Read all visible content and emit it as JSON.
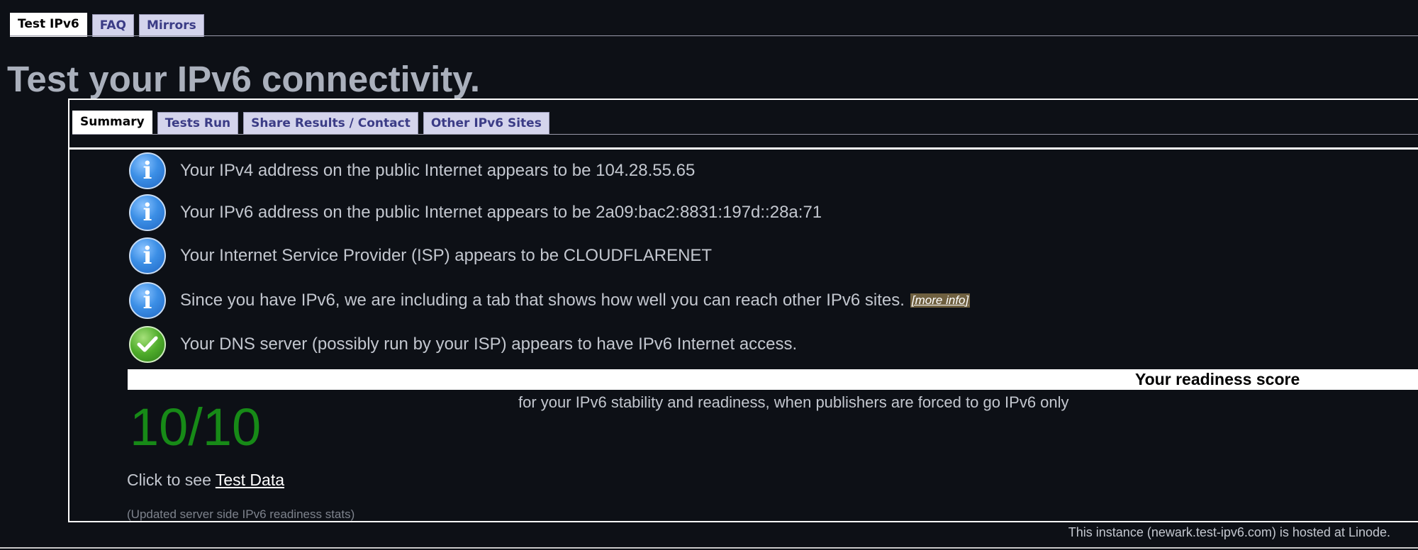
{
  "top_tabs": [
    {
      "label": "Test IPv6",
      "active": true
    },
    {
      "label": "FAQ",
      "active": false
    },
    {
      "label": "Mirrors",
      "active": false
    }
  ],
  "page_title": "Test your IPv6 connectivity.",
  "inner_tabs": [
    {
      "label": "Summary",
      "active": true
    },
    {
      "label": "Tests Run",
      "active": false
    },
    {
      "label": "Share Results / Contact",
      "active": false
    },
    {
      "label": "Other IPv6 Sites",
      "active": false
    }
  ],
  "messages": [
    {
      "icon": "info-icon",
      "text": "Your IPv4 address on the public Internet appears to be 104.28.55.65"
    },
    {
      "icon": "info-icon",
      "text": "Your IPv6 address on the public Internet appears to be 2a09:bac2:8831:197d::28a:71"
    },
    {
      "icon": "info-icon",
      "text": "Your Internet Service Provider (ISP) appears to be CLOUDFLARENET"
    },
    {
      "icon": "info-icon",
      "text": "Since you have IPv6, we are including a tab that shows how well you can reach other IPv6 sites.",
      "link": "[more info]"
    },
    {
      "icon": "checkmark-icon",
      "text": "Your DNS server (possibly run by your ISP) appears to have IPv6 Internet access."
    }
  ],
  "readiness": {
    "title": "Your readiness score",
    "subtitle": "for your IPv6 stability and readiness, when publishers are forced to go IPv6 only",
    "score": "10/10"
  },
  "test_data": {
    "prefix": "Click to see ",
    "link": "Test Data"
  },
  "updated_note": "(Updated server side IPv6 readiness stats)",
  "footer": "This instance (newark.test-ipv6.com) is hosted at Linode.",
  "colors": {
    "background": "#0d1016",
    "tab_inactive_bg": "#d4d4ec",
    "tab_inactive_text": "#3b3c86",
    "score_green": "#178a17",
    "info_blue": "#3c8fe6",
    "check_green": "#4fac2b"
  }
}
